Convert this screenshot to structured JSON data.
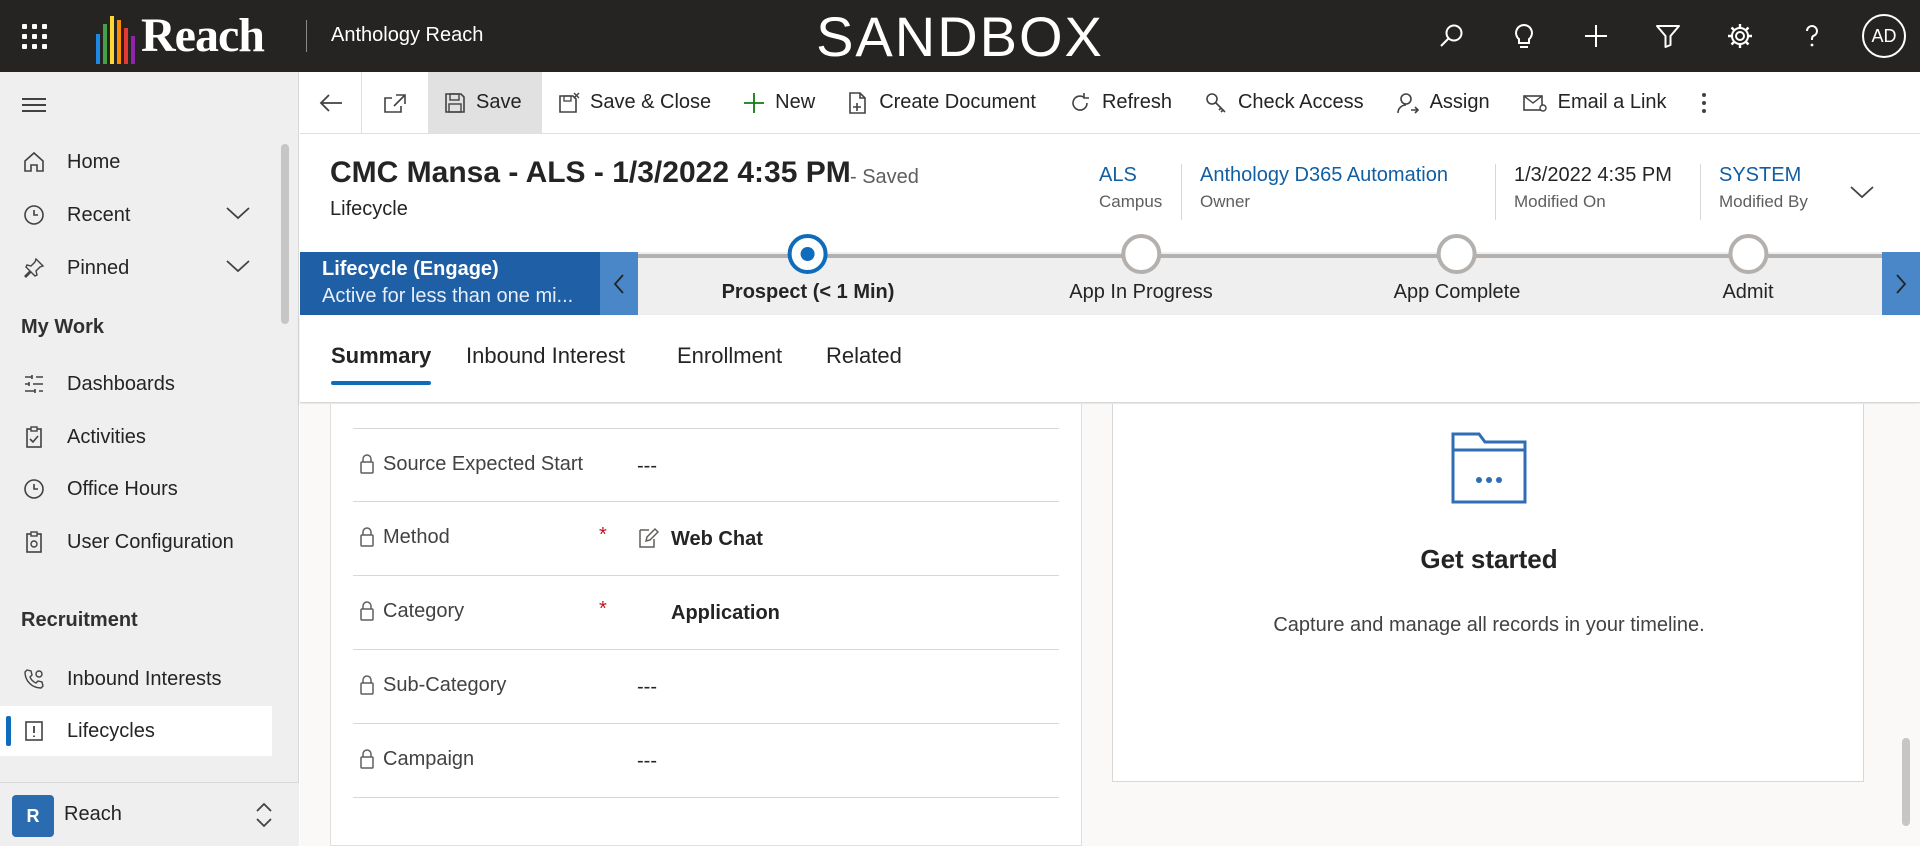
{
  "topbar": {
    "logo_text": "Reach",
    "app_name": "Anthology Reach",
    "environment_label": "SANDBOX",
    "avatar_initials": "AD",
    "icons": [
      "search-icon",
      "lightbulb-icon",
      "plus-icon",
      "filter-icon",
      "gear-icon",
      "help-icon"
    ]
  },
  "sidebar": {
    "items": [
      {
        "label": "Home",
        "icon": "home-icon"
      },
      {
        "label": "Recent",
        "icon": "clock-icon"
      },
      {
        "label": "Pinned",
        "icon": "pin-icon"
      }
    ],
    "section_my_work": "My Work",
    "my_work_items": [
      {
        "label": "Dashboards",
        "icon": "dashboard-icon"
      },
      {
        "label": "Activities",
        "icon": "clipboard-icon"
      },
      {
        "label": "Office Hours",
        "icon": "clock-icon"
      },
      {
        "label": "User Configuration",
        "icon": "clipboard-settings-icon"
      }
    ],
    "section_recruitment": "Recruitment",
    "recruitment_items": [
      {
        "label": "Inbound Interests",
        "icon": "phone-gear-icon"
      },
      {
        "label": "Lifecycles",
        "icon": "lifecycle-icon"
      }
    ],
    "area_badge": "R",
    "area_label": "Reach"
  },
  "commandbar": {
    "save": "Save",
    "save_close": "Save & Close",
    "new": "New",
    "create_document": "Create Document",
    "refresh": "Refresh",
    "check_access": "Check Access",
    "assign": "Assign",
    "email_link": "Email a Link"
  },
  "header": {
    "title": "CMC Mansa - ALS - 1/3/2022 4:35 PM",
    "status": "- Saved",
    "entity": "Lifecycle",
    "fields": [
      {
        "value": "ALS",
        "label": "Campus"
      },
      {
        "value": "Anthology D365 Automation",
        "label": "Owner"
      },
      {
        "value": "1/3/2022 4:35 PM",
        "label": "Modified On"
      },
      {
        "value": "SYSTEM",
        "label": "Modified By"
      }
    ]
  },
  "bpf": {
    "active_title": "Lifecycle (Engage)",
    "active_subtitle": "Active for less than one mi...",
    "stages": [
      {
        "name": "Prospect  (< 1 Min)",
        "active": true
      },
      {
        "name": "App In Progress",
        "active": false
      },
      {
        "name": "App Complete",
        "active": false
      },
      {
        "name": "Admit",
        "active": false
      }
    ]
  },
  "tabs": [
    "Summary",
    "Inbound Interest",
    "Enrollment",
    "Related"
  ],
  "form": {
    "fields": [
      {
        "label": "Source Expected Start",
        "value": "---",
        "required": false
      },
      {
        "label": "Method",
        "value": "Web Chat",
        "required": true
      },
      {
        "label": "Category",
        "value": "Application",
        "required": true
      },
      {
        "label": "Sub-Category",
        "value": "---",
        "required": false
      },
      {
        "label": "Campaign",
        "value": "---",
        "required": false
      }
    ],
    "required_marker": "*"
  },
  "timeline": {
    "title": "Get started",
    "subtitle": "Capture and manage all records in your timeline."
  },
  "colors": {
    "topbar": "#252423",
    "accent": "#0f6cbd",
    "bpf_active": "#1f5fa5",
    "link": "#115ea3",
    "required": "#c50f1f"
  }
}
